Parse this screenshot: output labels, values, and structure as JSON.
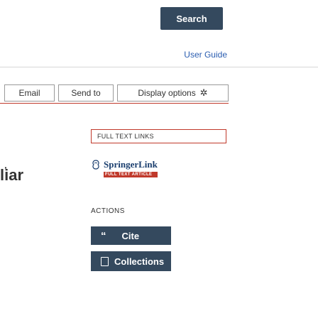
{
  "search": {
    "button_label": "Search",
    "placeholder": ""
  },
  "header": {
    "user_guide_label": "User Guide"
  },
  "toolbar": {
    "email_label": "Email",
    "send_to_label": "Send to",
    "display_options_label": "Display options"
  },
  "full_text_links": {
    "heading": "FULL TEXT LINKS",
    "springer_name": "SpringerLink",
    "springer_badge": "FULL TEXT ARTICLE"
  },
  "left_fragment": {
    "text": "liar"
  },
  "actions": {
    "heading": "ACTIONS",
    "cite_label": "Cite",
    "collections_label": "Collections"
  },
  "colors": {
    "button_bg": "#34495e",
    "accent_red": "#c0392b",
    "link": "#2a5db0"
  },
  "icons": {
    "cite": "quote-icon",
    "collections": "folder-icon",
    "display_options": "gear-icon",
    "springer": "springer-logo-icon"
  }
}
